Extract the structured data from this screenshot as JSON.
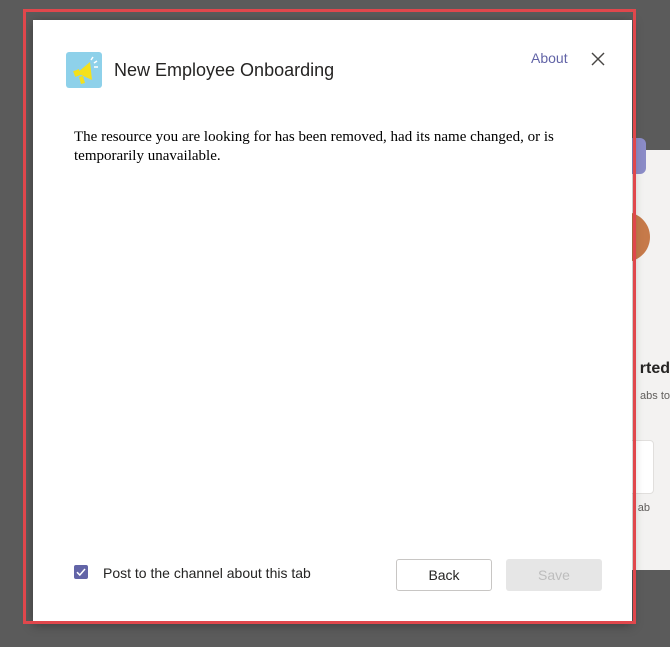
{
  "dialog": {
    "title": "New Employee Onboarding",
    "app_icon": "megaphone-icon",
    "about_label": "About",
    "close_icon": "close-icon",
    "message": "The resource you are looking for has been removed, had its name changed, or is temporarily unavailable.",
    "post_to_channel": {
      "label": "Post to the channel about this tab",
      "checked": true
    },
    "back_label": "Back",
    "save_label": "Save",
    "save_disabled": true
  },
  "background": {
    "heading_fragment": "rted",
    "sub_fragment": "abs to",
    "tab_fragment": "ab"
  },
  "colors": {
    "accent": "#6264a7",
    "highlight": "#e0474c",
    "icon_bg": "#8ed1ea",
    "overlay": "#5b5b5b"
  }
}
